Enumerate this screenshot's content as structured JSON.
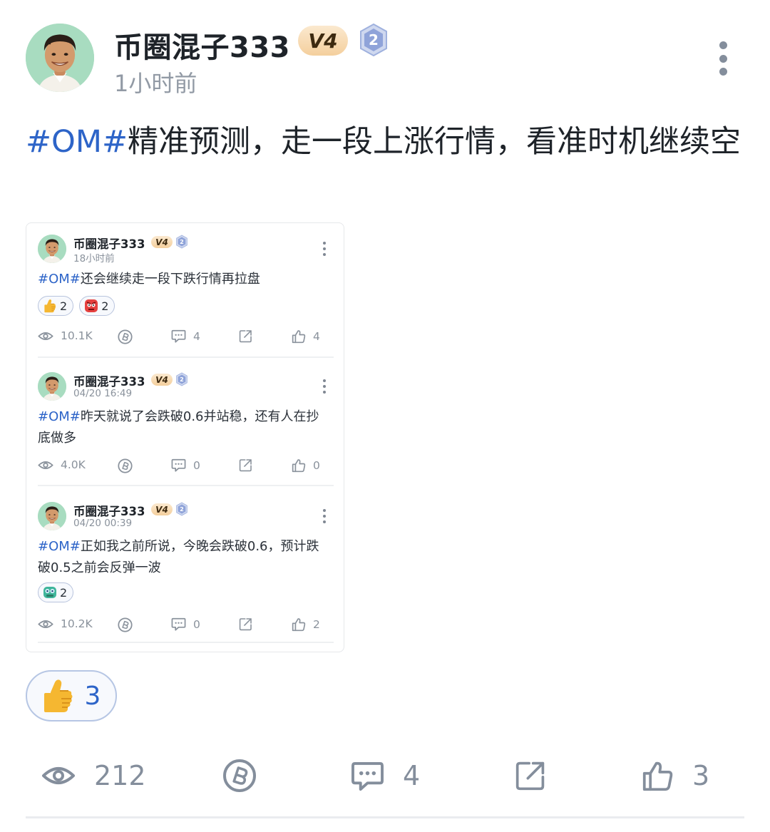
{
  "post": {
    "author": "币圈混子333",
    "vip_level": "V4",
    "badge_level": "2",
    "time": "1小时前",
    "hashtag": "#OM#",
    "text": "精准预测，走一段上涨行情，看准时机继续空",
    "reaction": {
      "emoji": "thumbs-up-icon",
      "count": "3"
    },
    "stats": {
      "views": "212",
      "comments": "4",
      "likes": "3"
    }
  },
  "embedded_posts": [
    {
      "author": "币圈混子333",
      "vip_level": "V4",
      "badge_level": "2",
      "time": "18小时前",
      "hashtag": "#OM#",
      "text": "还会继续走一段下跌行情再拉盘",
      "reactions": [
        {
          "emoji": "thumbs-up-icon",
          "count": "2"
        },
        {
          "emoji": "angry-face-icon",
          "count": "2"
        }
      ],
      "stats": {
        "views": "10.1K",
        "comments": "4",
        "likes": "4"
      }
    },
    {
      "author": "币圈混子333",
      "vip_level": "V4",
      "badge_level": "2",
      "time": "04/20 16:49",
      "hashtag": "#OM#",
      "text": "昨天就说了会跌破0.6并站稳，还有人在抄底做多",
      "reactions": [],
      "stats": {
        "views": "4.0K",
        "comments": "0",
        "likes": "0"
      }
    },
    {
      "author": "币圈混子333",
      "vip_level": "V4",
      "badge_level": "2",
      "time": "04/20 00:39",
      "hashtag": "#OM#",
      "text": "正如我之前所说，今晚会跌破0.6，预计跌破0.5之前会反弹一波",
      "reactions": [
        {
          "emoji": "frog-face-icon",
          "count": "2"
        }
      ],
      "stats": {
        "views": "10.2K",
        "comments": "0",
        "likes": "2"
      }
    }
  ],
  "colors": {
    "hashtag": "#2d64c8",
    "reaction_count": "#2d64c8",
    "muted_text": "#929aa5",
    "vip_badge": "#f4cf9d",
    "level_badge": "#8fa3d9"
  }
}
